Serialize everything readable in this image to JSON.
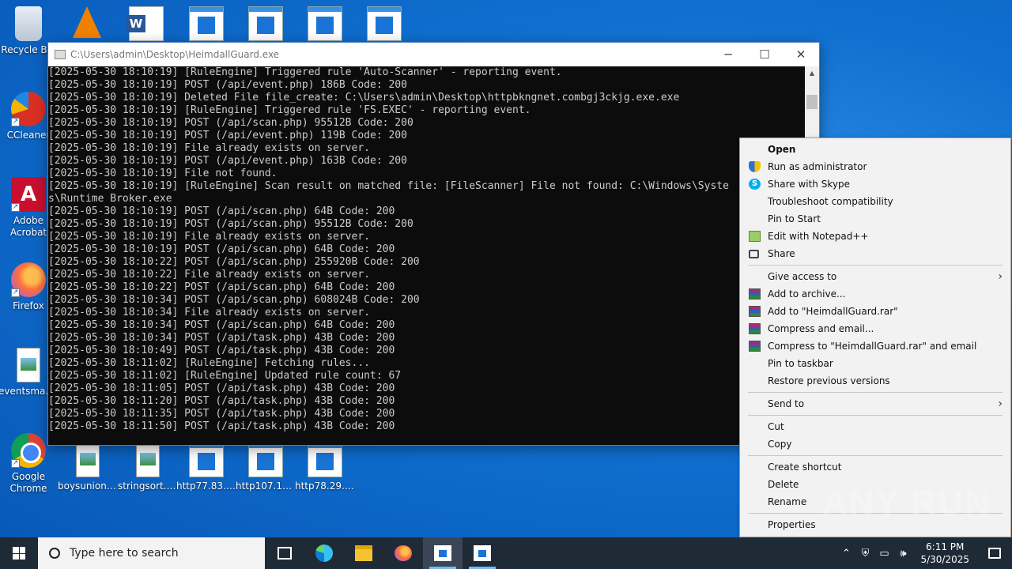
{
  "desktop": {
    "icons_left": [
      {
        "label": "Recycle Bin",
        "icon": "recycle-bin-icon"
      },
      {
        "label": "CCleaner",
        "icon": "ccleaner-icon"
      },
      {
        "label": "Adobe Acrobat",
        "icon": "acrobat-icon"
      },
      {
        "label": "Firefox",
        "icon": "firefox-icon"
      },
      {
        "label": "eventsman...",
        "icon": "image-file-icon"
      },
      {
        "label": "Google Chrome",
        "icon": "chrome-icon"
      }
    ],
    "icons_top": [
      "vlc-icon",
      "word-doc-icon",
      "window-file-icon",
      "window-file-icon",
      "window-file-icon",
      "window-file-shield-icon"
    ],
    "icons_bottom": [
      {
        "label": "boysunion....",
        "icon": "image-file-icon"
      },
      {
        "label": "stringsort.jpg",
        "icon": "image-file-icon"
      },
      {
        "label": "http77.83.2...",
        "icon": "window-file-icon"
      },
      {
        "label": "http107.175...",
        "icon": "window-file-icon"
      },
      {
        "label": "http78.29.4...",
        "icon": "window-file-icon"
      }
    ]
  },
  "console": {
    "title": "C:\\Users\\admin\\Desktop\\HeimdallGuard.exe",
    "lines": [
      "[2025-05-30 18:10:19] [RuleEngine] Triggered rule 'Auto-Scanner' - reporting event.",
      "[2025-05-30 18:10:19] POST (/api/event.php) 186B Code: 200",
      "[2025-05-30 18:10:19] Deleted File file_create: C:\\Users\\admin\\Desktop\\httpbkngnet.combgj3ckjg.exe.exe",
      "[2025-05-30 18:10:19] [RuleEngine] Triggered rule 'FS.EXEC' - reporting event.",
      "[2025-05-30 18:10:19] POST (/api/scan.php) 95512B Code: 200",
      "[2025-05-30 18:10:19] POST (/api/event.php) 119B Code: 200",
      "[2025-05-30 18:10:19] File already exists on server.",
      "[2025-05-30 18:10:19] POST (/api/event.php) 163B Code: 200",
      "[2025-05-30 18:10:19] File not found.",
      "[2025-05-30 18:10:19] [RuleEngine] Scan result on matched file: [FileScanner] File not found: C:\\Windows\\Syste",
      "s\\Runtime Broker.exe",
      "[2025-05-30 18:10:19] POST (/api/scan.php) 64B Code: 200",
      "[2025-05-30 18:10:19] POST (/api/scan.php) 95512B Code: 200",
      "[2025-05-30 18:10:19] File already exists on server.",
      "[2025-05-30 18:10:19] POST (/api/scan.php) 64B Code: 200",
      "[2025-05-30 18:10:22] POST (/api/scan.php) 255920B Code: 200",
      "[2025-05-30 18:10:22] File already exists on server.",
      "[2025-05-30 18:10:22] POST (/api/scan.php) 64B Code: 200",
      "[2025-05-30 18:10:34] POST (/api/scan.php) 608024B Code: 200",
      "[2025-05-30 18:10:34] File already exists on server.",
      "[2025-05-30 18:10:34] POST (/api/scan.php) 64B Code: 200",
      "[2025-05-30 18:10:34] POST (/api/task.php) 43B Code: 200",
      "[2025-05-30 18:10:49] POST (/api/task.php) 43B Code: 200",
      "[2025-05-30 18:11:02] [RuleEngine] Fetching rules...",
      "[2025-05-30 18:11:02] [RuleEngine] Updated rule count: 67",
      "[2025-05-30 18:11:05] POST (/api/task.php) 43B Code: 200",
      "[2025-05-30 18:11:20] POST (/api/task.php) 43B Code: 200",
      "[2025-05-30 18:11:35] POST (/api/task.php) 43B Code: 200",
      "[2025-05-30 18:11:50] POST (/api/task.php) 43B Code: 200"
    ]
  },
  "context_menu": {
    "items": [
      {
        "type": "item",
        "label": "Open",
        "bold": true
      },
      {
        "type": "item",
        "label": "Run as administrator",
        "icon": "shield-icon"
      },
      {
        "type": "item",
        "label": "Share with Skype",
        "icon": "skype-icon"
      },
      {
        "type": "item",
        "label": "Troubleshoot compatibility"
      },
      {
        "type": "item",
        "label": "Pin to Start"
      },
      {
        "type": "item",
        "label": "Edit with Notepad++",
        "icon": "notepad-plus-icon"
      },
      {
        "type": "item",
        "label": "Share",
        "icon": "share-icon"
      },
      {
        "type": "sep"
      },
      {
        "type": "item",
        "label": "Give access to",
        "submenu": true
      },
      {
        "type": "item",
        "label": "Add to archive...",
        "icon": "winrar-icon"
      },
      {
        "type": "item",
        "label": "Add to \"HeimdallGuard.rar\"",
        "icon": "winrar-icon"
      },
      {
        "type": "item",
        "label": "Compress and email...",
        "icon": "winrar-icon"
      },
      {
        "type": "item",
        "label": "Compress to \"HeimdallGuard.rar\" and email",
        "icon": "winrar-icon"
      },
      {
        "type": "item",
        "label": "Pin to taskbar"
      },
      {
        "type": "item",
        "label": "Restore previous versions"
      },
      {
        "type": "sep"
      },
      {
        "type": "item",
        "label": "Send to",
        "submenu": true
      },
      {
        "type": "sep"
      },
      {
        "type": "item",
        "label": "Cut"
      },
      {
        "type": "item",
        "label": "Copy"
      },
      {
        "type": "sep"
      },
      {
        "type": "item",
        "label": "Create shortcut"
      },
      {
        "type": "item",
        "label": "Delete"
      },
      {
        "type": "item",
        "label": "Rename"
      },
      {
        "type": "sep"
      },
      {
        "type": "item",
        "label": "Properties"
      }
    ]
  },
  "watermark": "ANY RUN",
  "taskbar": {
    "search_placeholder": "Type here to search",
    "apps": [
      "task-view-icon",
      "edge-icon",
      "file-explorer-icon",
      "firefox-icon",
      "console-app-icon",
      "window-app-icon"
    ],
    "time": "6:11 PM",
    "date": "5/30/2025"
  },
  "colors": {
    "console_bg": "#0c0c0c",
    "console_text": "#cccccc",
    "taskbar_bg": "#1f2a37",
    "menu_bg": "#f2f2f2"
  }
}
